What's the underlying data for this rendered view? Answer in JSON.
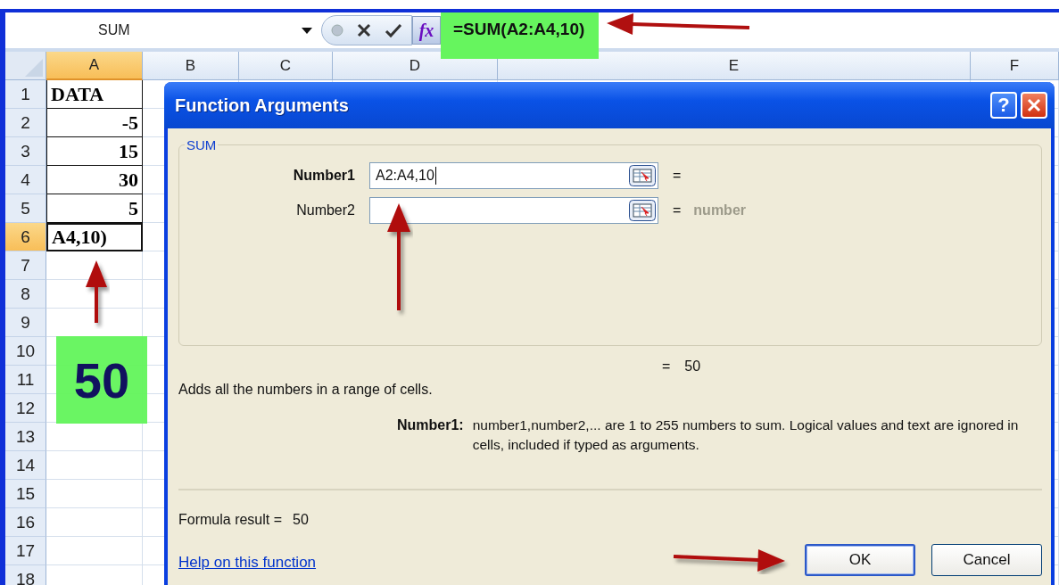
{
  "formula_bar": {
    "name_box": "SUM",
    "function_button": "fx",
    "formula": "=SUM(A2:A4,10)"
  },
  "columns": [
    {
      "label": "A",
      "selected": true
    },
    {
      "label": "B",
      "selected": false
    },
    {
      "label": "C",
      "selected": false
    },
    {
      "label": "D",
      "selected": false
    },
    {
      "label": "E",
      "selected": false
    },
    {
      "label": "F",
      "selected": false
    }
  ],
  "rows": [
    {
      "label": "1",
      "selected": false,
      "cell": {
        "value": "DATA",
        "kind": "text"
      }
    },
    {
      "label": "2",
      "selected": false,
      "cell": {
        "value": "-5",
        "kind": "number"
      }
    },
    {
      "label": "3",
      "selected": false,
      "cell": {
        "value": "15",
        "kind": "number"
      }
    },
    {
      "label": "4",
      "selected": false,
      "cell": {
        "value": "30",
        "kind": "number"
      }
    },
    {
      "label": "5",
      "selected": false,
      "cell": {
        "value": "5",
        "kind": "number"
      }
    },
    {
      "label": "6",
      "selected": true,
      "cell": {
        "value": "A4,10)",
        "kind": "text"
      }
    },
    {
      "label": "7",
      "selected": false
    },
    {
      "label": "8",
      "selected": false
    },
    {
      "label": "9",
      "selected": false
    },
    {
      "label": "10",
      "selected": false
    },
    {
      "label": "11",
      "selected": false
    },
    {
      "label": "12",
      "selected": false
    },
    {
      "label": "13",
      "selected": false
    },
    {
      "label": "14",
      "selected": false
    },
    {
      "label": "15",
      "selected": false
    },
    {
      "label": "16",
      "selected": false
    },
    {
      "label": "17",
      "selected": false
    },
    {
      "label": "18",
      "selected": false
    }
  ],
  "callout": "50",
  "dialog": {
    "title": "Function Arguments",
    "help_button": "?",
    "group_label": "SUM",
    "arguments": [
      {
        "label": "Number1",
        "active": true,
        "value": "A2:A4,10",
        "equals": "="
      },
      {
        "label": "Number2",
        "active": false,
        "equals": "=",
        "result": "number"
      }
    ],
    "function_result": {
      "equals": "=",
      "value": "50"
    },
    "description": "Adds all the numbers in a range of cells.",
    "argument_help": {
      "label": "Number1:",
      "text": "number1,number2,... are 1 to 255 numbers to sum. Logical values and text are ignored in cells, included if typed as arguments."
    },
    "formula_result": {
      "label": "Formula result =",
      "value": "50"
    },
    "help_link": "Help on this function",
    "buttons": [
      {
        "label": "OK",
        "default": true
      },
      {
        "label": "Cancel",
        "default": false
      }
    ]
  }
}
